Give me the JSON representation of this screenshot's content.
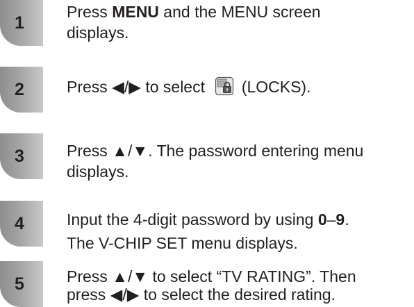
{
  "steps": [
    {
      "number": "1",
      "line1_prefix": "Press ",
      "line1_bold": "MENU",
      "line1_suffix": " and the MENU screen",
      "line2": "displays."
    },
    {
      "number": "2",
      "prefix": "Press ◀/▶ to select ",
      "icon": "locks-icon",
      "suffix": " (LOCKS)."
    },
    {
      "number": "3",
      "line1": "Press ▲/▼. The password entering menu",
      "line2": "displays."
    },
    {
      "number": "4",
      "line1_prefix": "Input the 4-digit password by using ",
      "line1_bold": "0",
      "line1_dash": "–",
      "line1_bold2": "9",
      "line1_suffix": ".",
      "line2": "The V-CHIP SET menu displays."
    },
    {
      "number": "5",
      "line1": "Press ▲/▼ to select “TV RATING”. Then",
      "line2": "press ◀/▶ to select the desired rating."
    }
  ]
}
